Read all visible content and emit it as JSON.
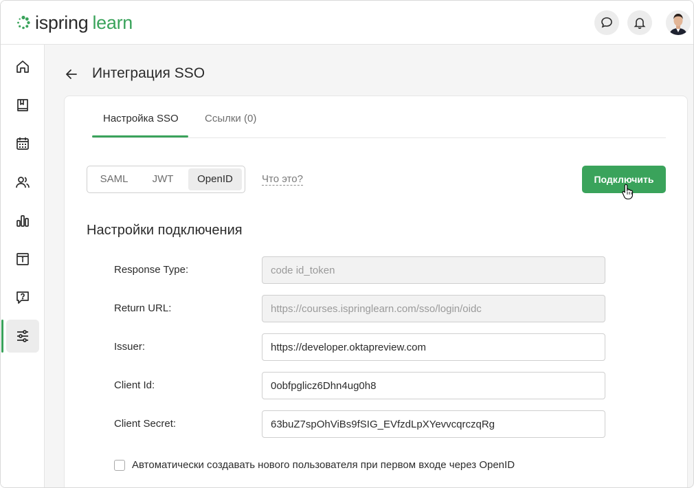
{
  "header": {
    "logo": {
      "part1": "ispring",
      "part2": "learn"
    },
    "accent": "#3aa35b",
    "icons": [
      "chat-icon",
      "bell-icon",
      "avatar"
    ]
  },
  "sidebar": {
    "items": [
      {
        "icon": "home-icon"
      },
      {
        "icon": "book-icon"
      },
      {
        "icon": "calendar-icon"
      },
      {
        "icon": "users-icon"
      },
      {
        "icon": "chart-icon"
      },
      {
        "icon": "info-box-icon"
      },
      {
        "icon": "help-chat-icon"
      },
      {
        "icon": "sliders-icon",
        "active": true
      }
    ]
  },
  "page": {
    "title": "Интеграция SSO"
  },
  "tabs": [
    {
      "label": "Настройка SSO",
      "active": true
    },
    {
      "label": "Ссылки (0)"
    }
  ],
  "protocols": {
    "options": [
      "SAML",
      "JWT",
      "OpenID"
    ],
    "selected": "OpenID",
    "help_link": "Что это?"
  },
  "connect_button": "Подключить",
  "section_title": "Настройки подключения",
  "fields": [
    {
      "label": "Response Type:",
      "value": "code id_token",
      "readonly": true
    },
    {
      "label": "Return URL:",
      "value": "https://courses.ispringlearn.com/sso/login/oidc",
      "readonly": true
    },
    {
      "label": "Issuer:",
      "value": "https://developer.oktapreview.com",
      "readonly": false
    },
    {
      "label": "Client Id:",
      "value": "0obfpglicz6Dhn4ug0h8",
      "readonly": false
    },
    {
      "label": "Client Secret:",
      "value": "63buZ7spOhViBs9fSIG_EVfzdLpXYevvcqrczqRg",
      "readonly": false
    }
  ],
  "auto_create": {
    "label": "Автоматически создавать нового пользователя при первом входе через OpenID",
    "checked": false
  }
}
